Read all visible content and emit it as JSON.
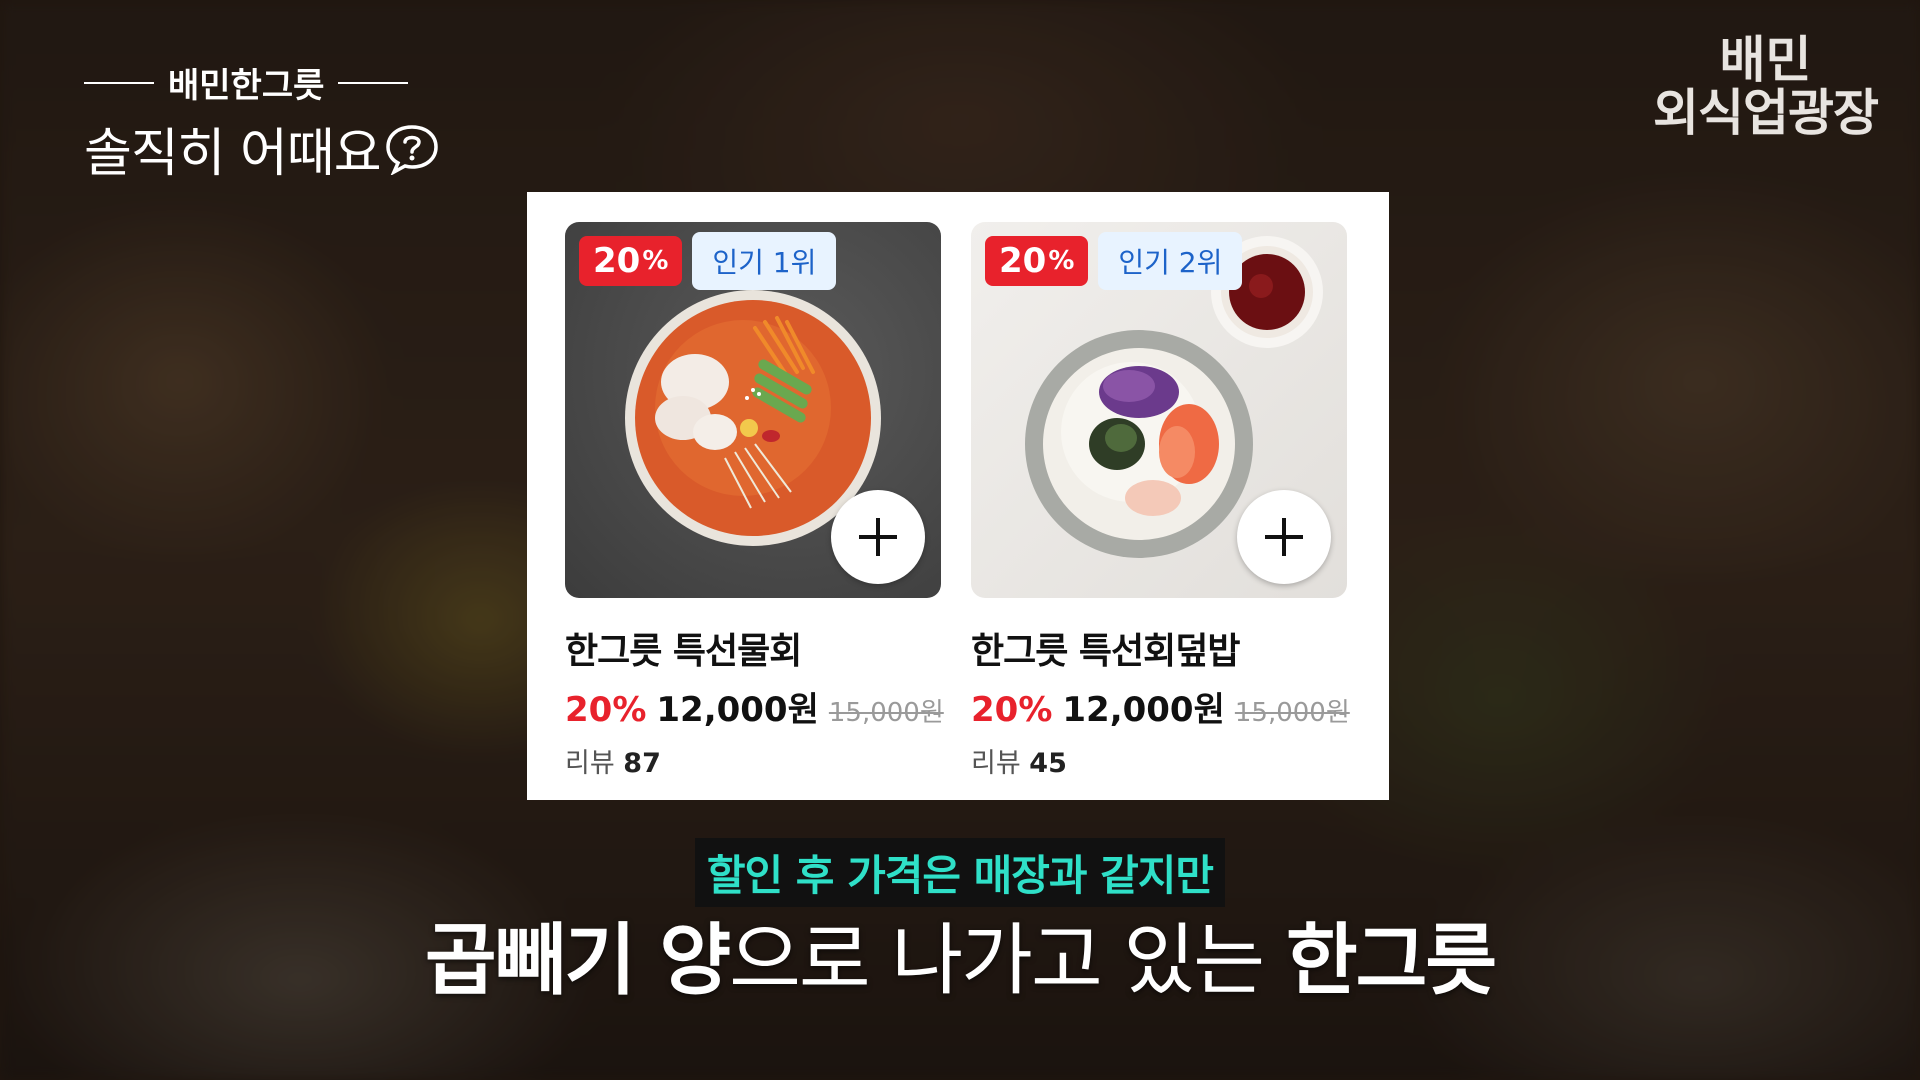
{
  "logo_left": {
    "brand": "배민한그릇",
    "subtitle": "솔직히 어때요"
  },
  "logo_right": {
    "line1": "배민",
    "line2": "외식업광장"
  },
  "products": [
    {
      "discount_badge": "20",
      "discount_badge_unit": "%",
      "rank_badge": "인기 1위",
      "name": "한그릇 특선물회",
      "discount": "20%",
      "price": "12,000원",
      "original_price": "15,000원",
      "review_label": "리뷰",
      "review_count": "87",
      "image_icon": "cold-raw-fish-soup-image",
      "add_icon": "plus-icon"
    },
    {
      "discount_badge": "20",
      "discount_badge_unit": "%",
      "rank_badge": "인기 2위",
      "name": "한그릇 특선회덮밥",
      "discount": "20%",
      "price": "12,000원",
      "original_price": "15,000원",
      "review_label": "리뷰",
      "review_count": "45",
      "image_icon": "raw-fish-rice-bowl-image",
      "add_icon": "plus-icon"
    }
  ],
  "captions": {
    "line1": "할인 후 가격은 매장과 같지만",
    "line2_part1": "곱빼기 양",
    "line2_part2": "으로 나가고 있는 ",
    "line2_part3": "한그릇"
  },
  "colors": {
    "discount_red": "#e8222c",
    "rank_badge_bg": "#e8f3ff",
    "rank_badge_text": "#1d63c9",
    "caption_accent": "#2fe0c8"
  }
}
